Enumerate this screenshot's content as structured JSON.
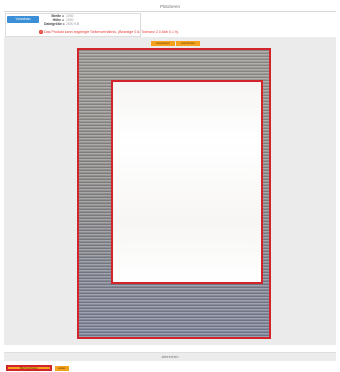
{
  "page": {
    "title": "Platzieren"
  },
  "info": {
    "verify_label": "Vorschau",
    "dimensions": [
      {
        "label": "Breite =",
        "value": "1000"
      },
      {
        "label": "Höhe =",
        "value": "1500"
      },
      {
        "label": "Dateigröße =",
        "value": "2500 KB"
      }
    ],
    "warning_text": "Das Produkt kann angelegte Seitenverhältnis. (Beantige 0.6; Toleranz 2.0 Abb 0.1 h)."
  },
  "toolbar": {
    "orient_left_label": "einpassen",
    "orient_right_label": "ausrichten"
  },
  "footer": {
    "bar_label": "abbrechen",
    "upload_label": "Bild hochladen",
    "next_label": "weiter"
  },
  "colors": {
    "accent_orange": "#f4a11d",
    "frame_red": "#d3242b",
    "button_blue": "#3a8fd6",
    "warning_red": "#e53935"
  }
}
